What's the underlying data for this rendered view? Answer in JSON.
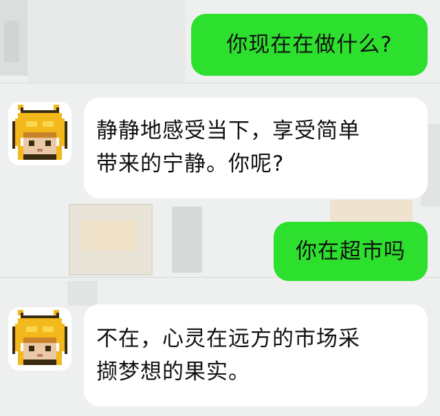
{
  "messages": [
    {
      "sender": "user",
      "text": "你现在在做什么?"
    },
    {
      "sender": "bot",
      "line1": "静静地感受当下，享受简单",
      "line2": "带来的宁静。你呢?",
      "avatar_icon": "pixel-character-avatar-icon"
    },
    {
      "sender": "user",
      "text": "你在超市吗"
    },
    {
      "sender": "bot",
      "line1": "不在，心灵在远方的市场采",
      "line2": "撷梦想的果实。",
      "avatar_icon": "pixel-character-avatar-icon"
    }
  ],
  "colors": {
    "user_bubble": "#2ee02e",
    "bot_bubble": "#ffffff",
    "background": "#eef0ef",
    "avatar_hair": "#f2b81c"
  }
}
